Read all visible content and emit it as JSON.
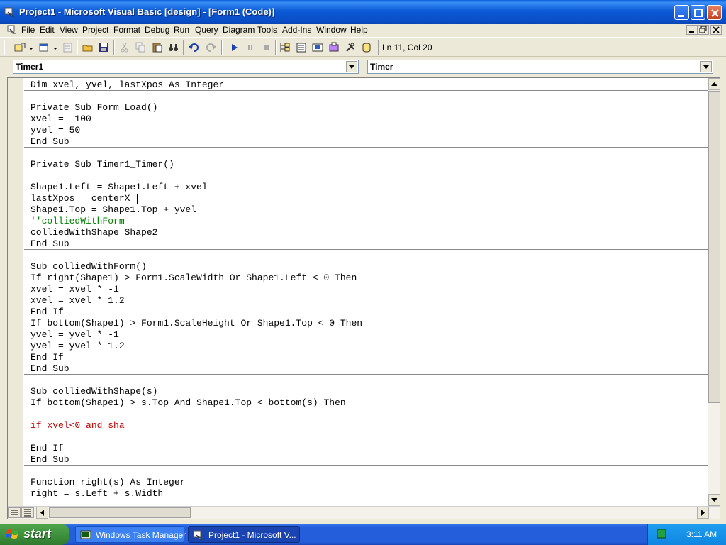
{
  "window": {
    "title": "Project1 - Microsoft Visual Basic [design] - [Form1 (Code)]"
  },
  "menu": {
    "items": [
      "File",
      "Edit",
      "View",
      "Project",
      "Format",
      "Debug",
      "Run",
      "Query",
      "Diagram",
      "Tools",
      "Add-Ins",
      "Window",
      "Help"
    ]
  },
  "toolbar": {
    "position": "Ln 11, Col 20",
    "icons": [
      "add-project-icon",
      "add-form-icon",
      "menu-editor-icon",
      "open-icon",
      "save-icon",
      "cut-icon",
      "copy-icon",
      "paste-icon",
      "find-icon",
      "undo-icon",
      "redo-icon",
      "start-icon",
      "break-icon",
      "end-icon",
      "project-explorer-icon",
      "properties-window-icon",
      "form-layout-icon",
      "object-browser-icon",
      "toolbox-icon",
      "data-view-icon"
    ]
  },
  "object_combo": {
    "value": "Timer1"
  },
  "procedure_combo": {
    "value": "Timer"
  },
  "code": {
    "lines": [
      "Dim xvel, yvel, lastXpos As Integer",
      "",
      "Private Sub Form_Load()",
      "xvel = -100",
      "yvel = 50",
      "End Sub",
      "",
      "Private Sub Timer1_Timer()",
      "",
      "Shape1.Left = Shape1.Left + xvel",
      "lastXpos = centerX ",
      "Shape1.Top = Shape1.Top + yvel",
      "''colliedWithForm",
      "colliedWithShape Shape2",
      "End Sub",
      "",
      "Sub colliedWithForm()",
      "If right(Shape1) > Form1.ScaleWidth Or Shape1.Left < 0 Then",
      "xvel = xvel * -1",
      "xvel = xvel * 1.2",
      "End If",
      "If bottom(Shape1) > Form1.ScaleHeight Or Shape1.Top < 0 Then",
      "yvel = yvel * -1",
      "yvel = yvel * 1.2",
      "End If",
      "End Sub",
      "",
      "Sub colliedWithShape(s)",
      "If bottom(Shape1) > s.Top And Shape1.Top < bottom(s) Then",
      "",
      "if xvel<0 and sha",
      "",
      "End If",
      "End Sub",
      "",
      "Function right(s) As Integer",
      "right = s.Left + s.Width"
    ]
  },
  "taskbar": {
    "start_label": "start",
    "tasks": [
      {
        "label": "Windows Task Manager",
        "active": false
      },
      {
        "label": "Project1 - Microsoft V...",
        "active": true
      }
    ],
    "clock": "3:11 AM"
  },
  "colors": {
    "comment": "#008000",
    "syntax_error": "#c00000",
    "title_bar": "#0a5fd8",
    "taskbar": "#245edb",
    "start_button": "#3c8e3c"
  }
}
